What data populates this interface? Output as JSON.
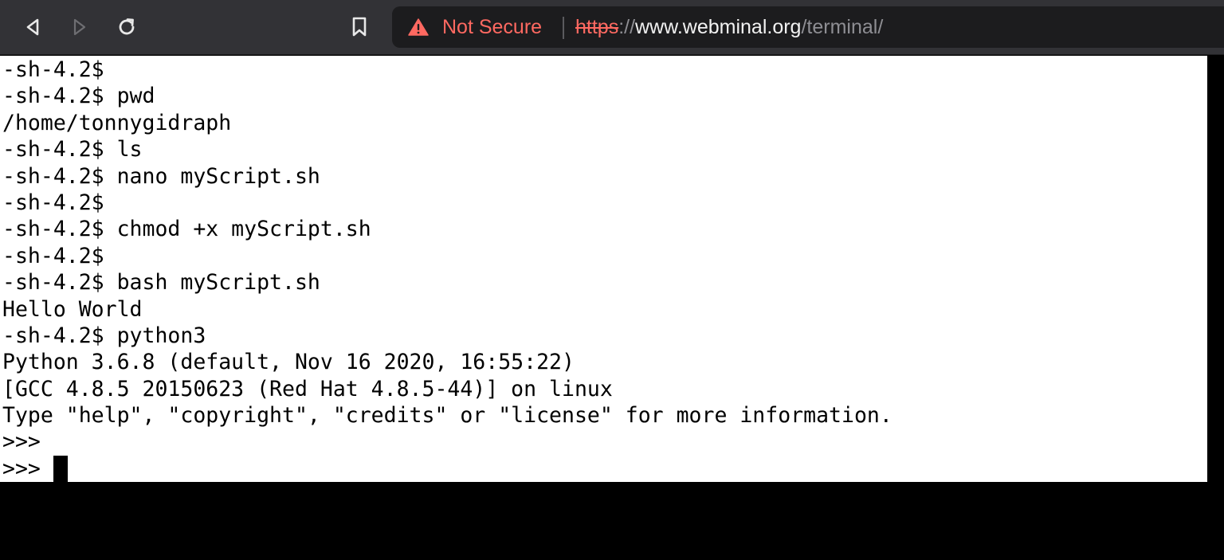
{
  "browser": {
    "security_label": "Not Secure",
    "url": {
      "scheme": "https",
      "separator": "://",
      "host": "www.webminal.org",
      "path": "/terminal/"
    },
    "colors": {
      "toolbar_bg": "#323236",
      "urlbar_bg": "#1c1c1e",
      "warning": "#ff6961"
    },
    "icons": {
      "back": "back-arrow-icon",
      "forward": "forward-arrow-icon",
      "reload": "reload-icon",
      "bookmark": "bookmark-icon",
      "security": "warning-triangle-icon"
    }
  },
  "terminal": {
    "lines": [
      "-sh-4.2$",
      "-sh-4.2$ pwd",
      "/home/tonnygidraph",
      "-sh-4.2$ ls",
      "-sh-4.2$ nano myScript.sh",
      "-sh-4.2$",
      "-sh-4.2$ chmod +x myScript.sh",
      "-sh-4.2$",
      "-sh-4.2$ bash myScript.sh",
      "Hello World",
      "-sh-4.2$ python3",
      "Python 3.6.8 (default, Nov 16 2020, 16:55:22)",
      "[GCC 4.8.5 20150623 (Red Hat 4.8.5-44)] on linux",
      "Type \"help\", \"copyright\", \"credits\" or \"license\" for more information.",
      ">>>"
    ],
    "prompt": ">>>",
    "colors": {
      "background": "#ffffff",
      "text": "#000000"
    }
  }
}
